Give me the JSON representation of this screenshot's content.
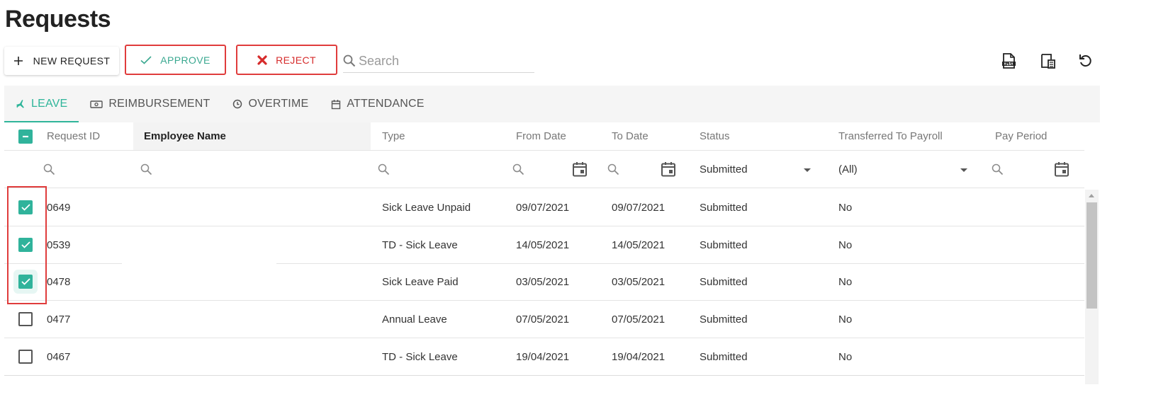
{
  "page": {
    "title": "Requests"
  },
  "toolbar": {
    "new_label": "NEW REQUEST",
    "approve_label": "APPROVE",
    "reject_label": "REJECT",
    "search_placeholder": "Search",
    "icons": [
      "export-xlsx-icon",
      "column-chooser-icon",
      "refresh-icon"
    ]
  },
  "tabs": [
    {
      "label": "LEAVE",
      "icon": "airplane-icon",
      "active": true
    },
    {
      "label": "REIMBURSEMENT",
      "icon": "money-icon",
      "active": false
    },
    {
      "label": "OVERTIME",
      "icon": "clock-icon",
      "active": false
    },
    {
      "label": "ATTENDANCE",
      "icon": "calendar-icon",
      "active": false
    }
  ],
  "grid": {
    "columns": [
      "Request ID",
      "Employee Name",
      "Type",
      "From Date",
      "To Date",
      "Status",
      "Transferred To Payroll",
      "Pay Period"
    ],
    "filters": {
      "status": "Submitted",
      "payroll": "(All)"
    },
    "rows": [
      {
        "id": "0649",
        "type": "Sick Leave Unpaid",
        "from": "09/07/2021",
        "to": "09/07/2021",
        "status": "Submitted",
        "payroll": "No",
        "checked": true
      },
      {
        "id": "0539",
        "type": "TD - Sick Leave",
        "from": "14/05/2021",
        "to": "14/05/2021",
        "status": "Submitted",
        "payroll": "No",
        "checked": true
      },
      {
        "id": "0478",
        "type": "Sick Leave Paid",
        "from": "03/05/2021",
        "to": "03/05/2021",
        "status": "Submitted",
        "payroll": "No",
        "checked": true
      },
      {
        "id": "0477",
        "type": "Annual Leave",
        "from": "07/05/2021",
        "to": "07/05/2021",
        "status": "Submitted",
        "payroll": "No",
        "checked": false
      },
      {
        "id": "0467",
        "type": "TD - Sick Leave",
        "from": "19/04/2021",
        "to": "19/04/2021",
        "status": "Submitted",
        "payroll": "No",
        "checked": false
      }
    ]
  },
  "colors": {
    "accent": "#30b39b",
    "reject": "#d62b2b",
    "highlight": "#e03c3c"
  }
}
